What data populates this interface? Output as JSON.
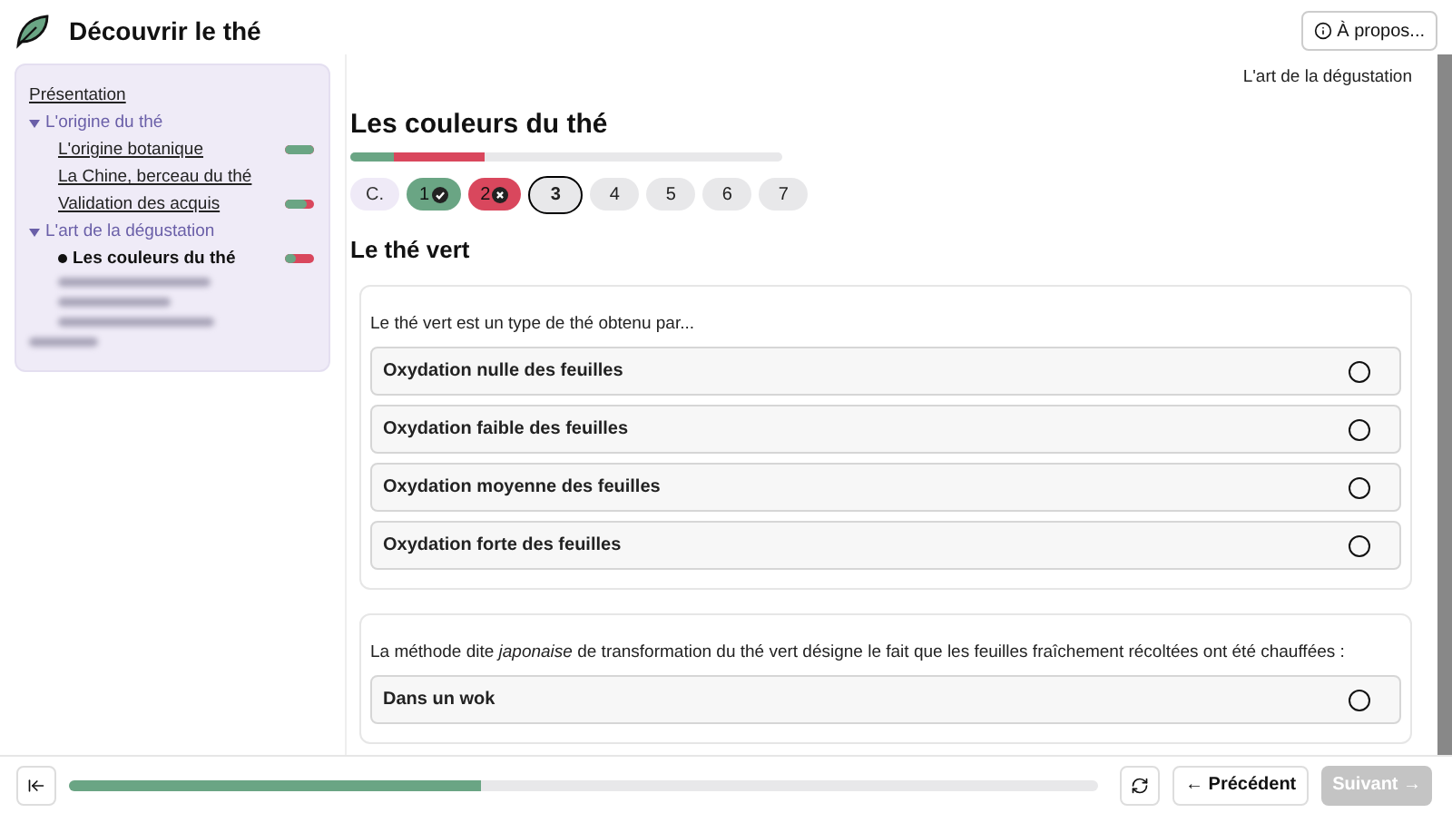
{
  "app": {
    "title": "Découvrir le thé"
  },
  "about_button": {
    "label": "À propos..."
  },
  "sidebar": {
    "items": [
      {
        "kind": "link",
        "label": "Présentation",
        "current": false
      },
      {
        "kind": "section",
        "label": "L'origine du thé",
        "expanded": true,
        "children": [
          {
            "kind": "link",
            "label": "L'origine botanique",
            "current": false,
            "score": {
              "level": 1
            }
          },
          {
            "kind": "link",
            "label": "La Chine, berceau du thé",
            "current": false
          },
          {
            "kind": "link",
            "label": "Validation des acquis",
            "current": false,
            "score": {
              "level": 0.75
            }
          }
        ]
      },
      {
        "kind": "section",
        "label": "L'art de la dégustation",
        "expanded": true,
        "children": [
          {
            "kind": "link",
            "label": "Les couleurs du thé",
            "current": true,
            "score": {
              "level": 0.4
            }
          },
          {
            "kind": "blurred",
            "wrapped": true
          },
          {
            "kind": "blurred",
            "wrapped": false
          }
        ]
      },
      {
        "kind": "blurred",
        "wrapped": false
      }
    ]
  },
  "breadcrumb": "L'art de la dégustation",
  "lesson": {
    "title": "Les couleurs du thé",
    "progress": [
      {
        "kind": "correct",
        "level": 0.1
      },
      {
        "kind": "wrong",
        "level": 0.21
      }
    ],
    "pills": [
      {
        "label": "C.",
        "kind": "intro",
        "selected": false
      },
      {
        "label": "1",
        "kind": "correct",
        "selected": false
      },
      {
        "label": "2",
        "kind": "wrong",
        "selected": false
      },
      {
        "label": "3",
        "kind": "todo",
        "selected": true
      },
      {
        "label": "4",
        "kind": "todo",
        "selected": false
      },
      {
        "label": "5",
        "kind": "todo",
        "selected": false
      },
      {
        "label": "6",
        "kind": "todo",
        "selected": false
      },
      {
        "label": "7",
        "kind": "todo",
        "selected": false
      }
    ],
    "heading": "Le thé vert",
    "questions": [
      {
        "prompt": "Le thé vert est un type de thé obtenu par...",
        "options": [
          {
            "label": "Oxydation nulle des feuilles",
            "selected": false
          },
          {
            "label": "Oxydation faible des feuilles",
            "selected": false
          },
          {
            "label": "Oxydation moyenne des feuilles",
            "selected": false
          },
          {
            "label": "Oxydation forte des feuilles",
            "selected": false
          }
        ]
      },
      {
        "prompt": "La méthode dite *japonaise* de transformation du thé vert désigne le fait que les feuilles fraîchement récoltées ont été chauffées :",
        "options": [
          {
            "label": "Dans un wok",
            "selected": false
          }
        ]
      }
    ]
  },
  "footer": {
    "progress": {
      "level": 0.4
    },
    "previous": {
      "label": "← Précédent",
      "disabled": false
    },
    "next": {
      "label": "Suivant →",
      "disabled": true
    }
  }
}
